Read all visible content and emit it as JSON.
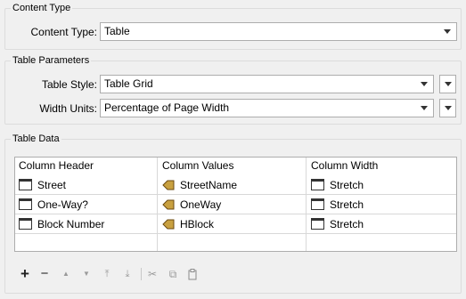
{
  "content_type": {
    "group_title": "Content Type",
    "label": "Content Type:",
    "value": "Table"
  },
  "table_parameters": {
    "group_title": "Table Parameters",
    "style_label": "Table Style:",
    "style_value": "Table Grid",
    "width_label": "Width Units:",
    "width_value": "Percentage of Page Width"
  },
  "table_data": {
    "group_title": "Table Data",
    "columns": [
      "Column Header",
      "Column Values",
      "Column Width"
    ],
    "rows": [
      {
        "header": "Street",
        "values": "StreetName",
        "width": "Stretch"
      },
      {
        "header": "One-Way?",
        "values": "OneWay",
        "width": "Stretch"
      },
      {
        "header": "Block Number",
        "values": "HBlock",
        "width": "Stretch"
      }
    ]
  },
  "toolbar": {
    "add": "+",
    "remove": "−",
    "move_up": "▲",
    "move_down": "▼",
    "move_top": "⤒",
    "move_bottom": "⤓",
    "cut": "✂",
    "copy": "⧉",
    "paste": "📋"
  },
  "icons": {
    "text_cell": "text-cell-icon",
    "attribute": "attribute-icon"
  },
  "colors": {
    "attribute_icon_fill": "#c8a040",
    "attribute_icon_stroke": "#6b4a10"
  }
}
